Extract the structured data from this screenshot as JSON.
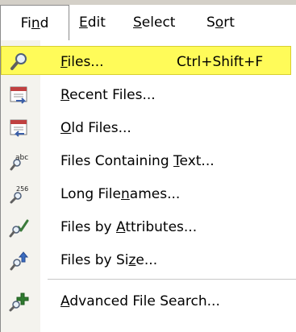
{
  "menubar": {
    "menus": [
      {
        "pre": "Fi",
        "acc": "n",
        "post": "d"
      },
      {
        "pre": "",
        "acc": "E",
        "post": "dit"
      },
      {
        "pre": "",
        "acc": "S",
        "post": "elect"
      },
      {
        "pre": "S",
        "acc": "o",
        "post": "rt"
      }
    ]
  },
  "dropdown": {
    "items": [
      {
        "pre": "",
        "acc": "F",
        "post": "iles...",
        "shortcut": "Ctrl+Shift+F",
        "icon": "magnifier-icon"
      },
      {
        "pre": "",
        "acc": "R",
        "post": "ecent Files...",
        "icon": "recent-files-calendar-icon"
      },
      {
        "pre": "",
        "acc": "O",
        "post": "ld Files...",
        "icon": "old-files-calendar-icon"
      },
      {
        "pre": "Files Containing ",
        "acc": "T",
        "post": "ext...",
        "icon": "text-search-icon",
        "icon_text": "abc"
      },
      {
        "pre": "Long File",
        "acc": "n",
        "post": "ames...",
        "icon": "long-filename-search-icon",
        "icon_text": "256"
      },
      {
        "pre": "Files by ",
        "acc": "A",
        "post": "ttributes...",
        "icon": "attributes-check-icon"
      },
      {
        "pre": "Files by Si",
        "acc": "z",
        "post": "e...",
        "icon": "size-arrow-icon"
      },
      {
        "pre": "",
        "acc": "A",
        "post": "dvanced File Search...",
        "icon": "advanced-search-plus-icon"
      }
    ]
  },
  "colors": {
    "highlight": "#fffb59",
    "icon_column": "#f4f3ee",
    "menu_border": "#8c8c8c"
  }
}
